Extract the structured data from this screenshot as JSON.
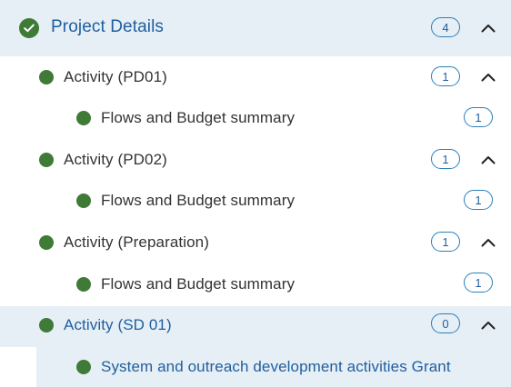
{
  "header": {
    "title": "Project Details",
    "count": "4",
    "icon": "check-circle-icon"
  },
  "activities": [
    {
      "label": "Activity (PD01)",
      "count": "1",
      "children": [
        {
          "label": "Flows and Budget summary",
          "count": "1"
        }
      ]
    },
    {
      "label": "Activity (PD02)",
      "count": "1",
      "children": [
        {
          "label": "Flows and Budget summary",
          "count": "1"
        }
      ]
    },
    {
      "label": "Activity (Preparation)",
      "count": "1",
      "children": [
        {
          "label": "Flows and Budget summary",
          "count": "1"
        }
      ]
    },
    {
      "label": "Activity (SD 01)",
      "count": "0",
      "children": [
        {
          "label": "System and outreach development activities Grant"
        }
      ]
    }
  ],
  "colors": {
    "status_dot": "#3f7a37",
    "link_blue": "#1f5f9e",
    "badge_border": "#2b7fb8",
    "selected_bg": "#e6eef6"
  }
}
